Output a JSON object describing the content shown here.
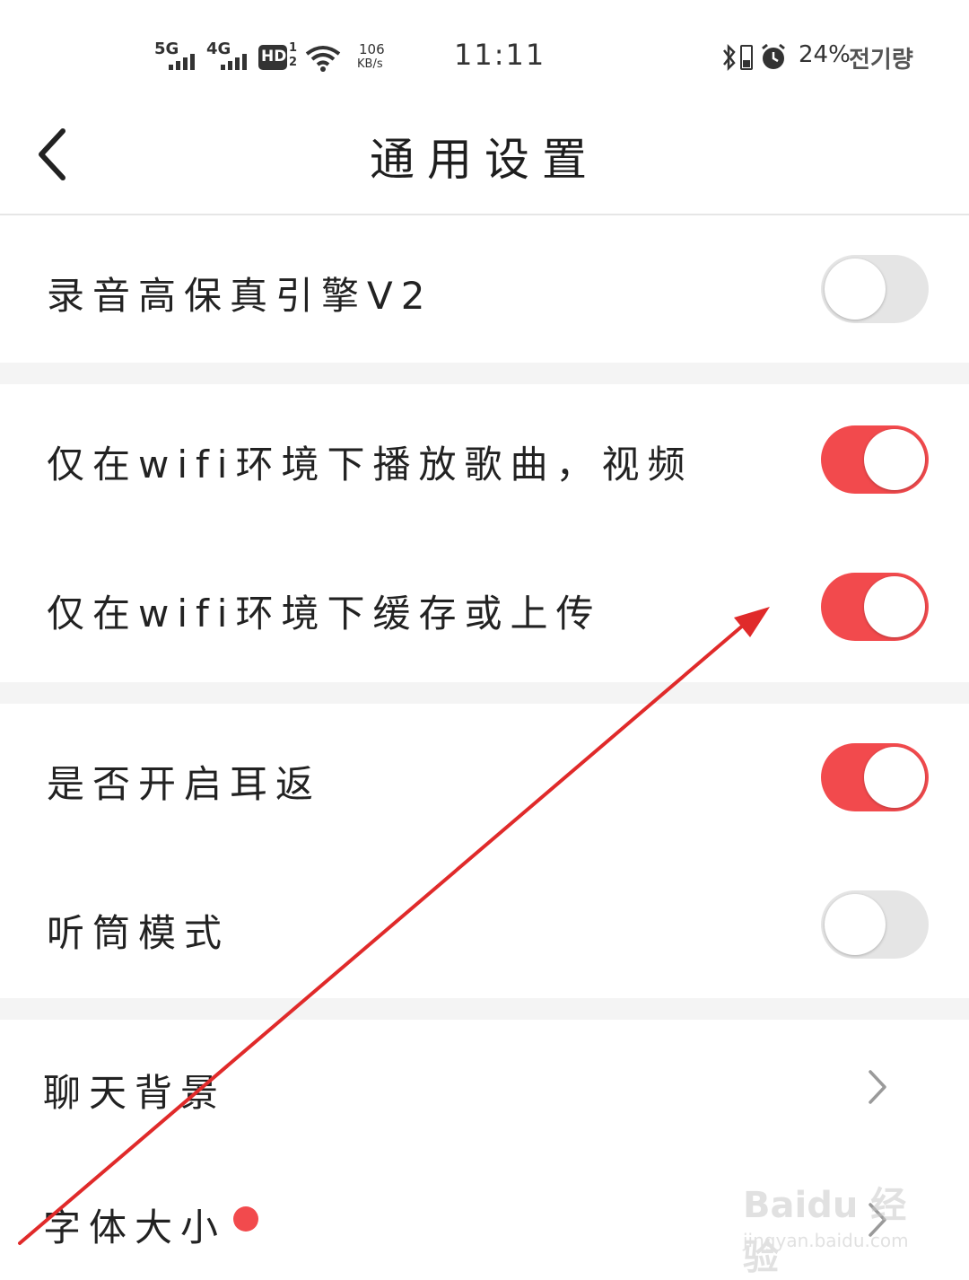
{
  "status_bar": {
    "signal1_label": "5G",
    "signal2_label": "4G",
    "hd_label": "HD",
    "hd_sup": "1",
    "hd_sub": "2",
    "speed_value": "106",
    "speed_unit": "KB/s",
    "time": "11:11",
    "battery_percent": "24%",
    "carrier": "전기량"
  },
  "header": {
    "title": "通用设置"
  },
  "settings": [
    {
      "label": "录音高保真引擎V2",
      "type": "toggle",
      "on": false
    },
    {
      "label": "仅在wifi环境下播放歌曲，视频",
      "type": "toggle",
      "on": true
    },
    {
      "label": "仅在wifi环境下缓存或上传",
      "type": "toggle",
      "on": true
    },
    {
      "label": "是否开启耳返",
      "type": "toggle",
      "on": true
    },
    {
      "label": "听筒模式",
      "type": "toggle",
      "on": false
    },
    {
      "label": "聊天背景",
      "type": "link"
    },
    {
      "label": "字体大小",
      "type": "link",
      "badge": "new-dot"
    }
  ],
  "watermark": {
    "main": "Baidu 经验",
    "sub": "jingyan.baidu.com"
  },
  "colors": {
    "accent": "#f24a4d",
    "toggle_off": "#e5e5e5",
    "section_gap": "#f4f4f4",
    "annotation_arrow": "#e02a2a"
  }
}
